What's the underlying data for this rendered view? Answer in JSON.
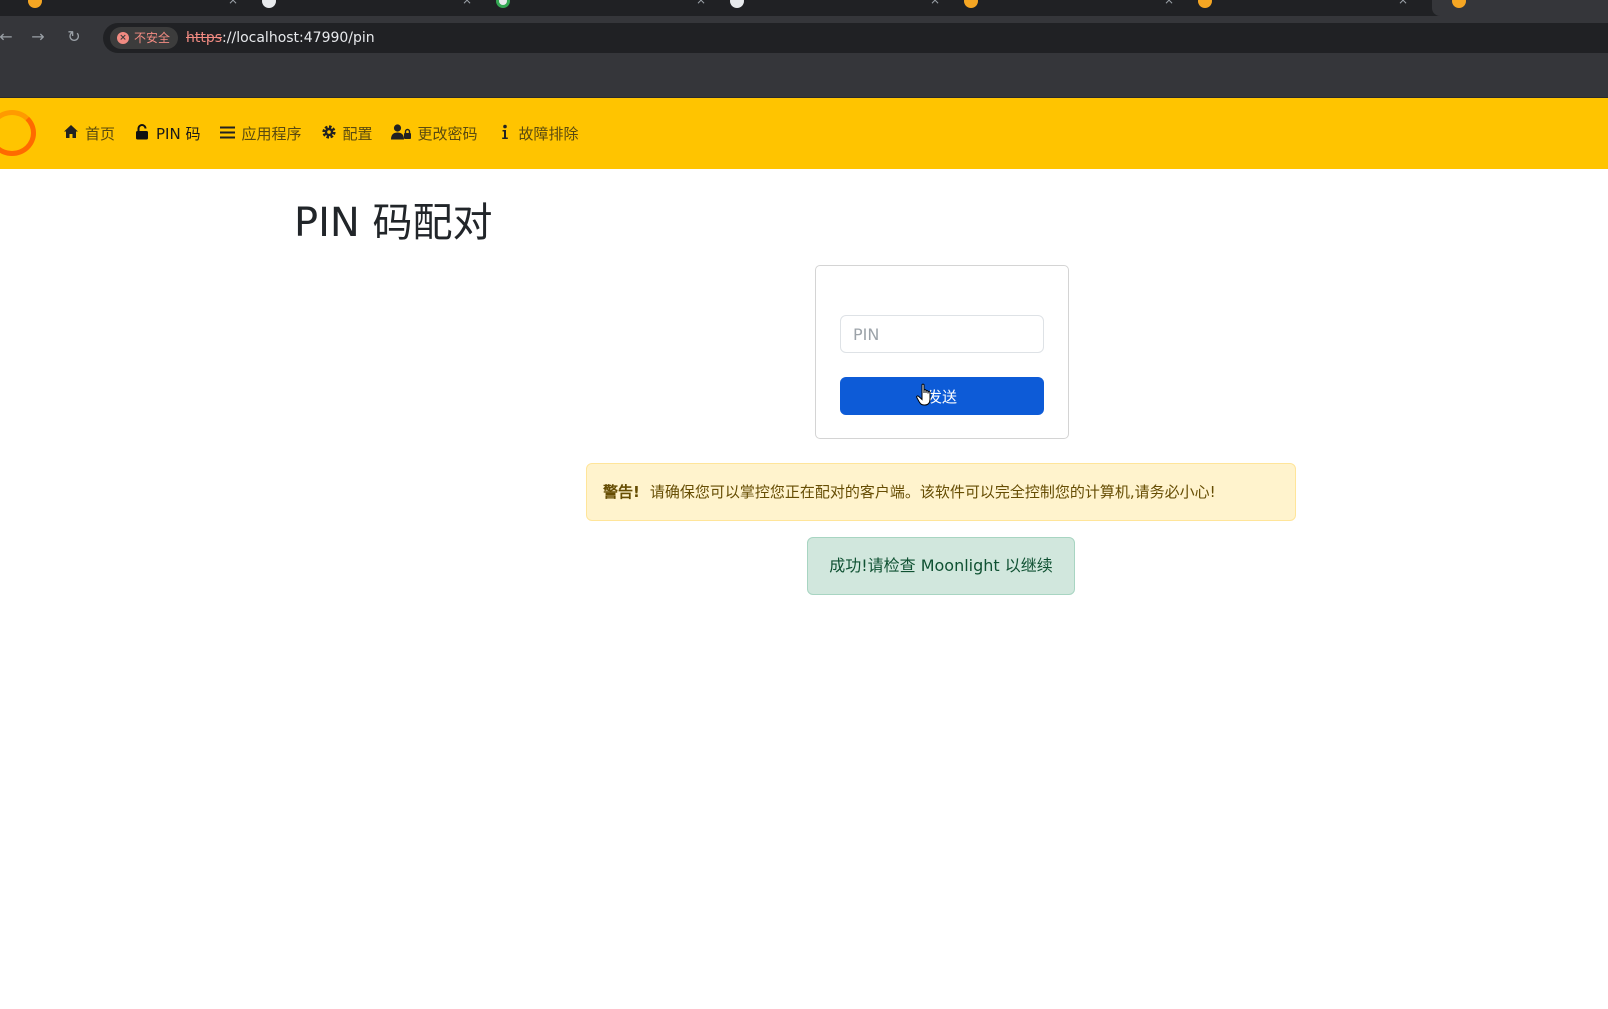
{
  "browser": {
    "security_chip": "不安全",
    "url_scheme": "https",
    "url_rest": "://localhost:47990/pin",
    "nav": {
      "back_icon": "arrow-left-icon",
      "forward_icon": "arrow-right-icon",
      "reload_icon": "reload-icon"
    }
  },
  "navbar": {
    "links": [
      {
        "label": "首页",
        "icon": "home-icon"
      },
      {
        "label": "PIN 码",
        "icon": "lock-icon"
      },
      {
        "label": "应用程序",
        "icon": "list-icon"
      },
      {
        "label": "配置",
        "icon": "gear-icon"
      },
      {
        "label": "更改密码",
        "icon": "user-lock-icon"
      },
      {
        "label": "故障排除",
        "icon": "info-icon"
      }
    ],
    "active_index": 1
  },
  "page": {
    "title": "PIN 码配对",
    "pin_form": {
      "placeholder": "PIN",
      "value": "",
      "submit_label": "发送"
    },
    "warning": {
      "strong": "警告!",
      "text": "请确保您可以掌控您正在配对的客户端。该软件可以完全控制您的计算机,请务必小心!"
    },
    "success": {
      "text": "成功!请检查 Moonlight 以继续"
    }
  },
  "colors": {
    "navbar_bg": "#ffc400",
    "primary": "#0d5bd7",
    "warning_bg": "#fff3cd",
    "success_bg": "#d1e7dd"
  }
}
